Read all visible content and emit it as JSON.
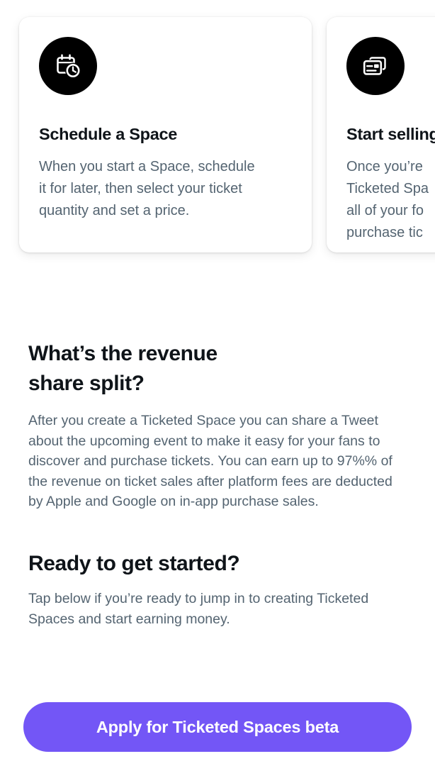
{
  "colors": {
    "page_background": "#ffffff",
    "card_background": "#ffffff",
    "heading_text": "#0f1419",
    "body_text": "#546471",
    "icon_badge": "#000000",
    "cta_background": "#7356f6",
    "cta_text": "#ffffff"
  },
  "cards": [
    {
      "icon": "calendar-clock-icon",
      "title": "Schedule a Space",
      "body": "When you start a Space, schedule\nit for later, then select your ticket\nquantity and set a price."
    },
    {
      "icon": "ticket-cards-icon",
      "title": "Start selling",
      "body": "Once you’re\nTicketed Spa\nall of your fo\npurchase tic"
    }
  ],
  "sections": [
    {
      "heading": "What’s the revenue\nshare split?",
      "body": "After you create a Ticketed Space you can share a Tweet about the upcoming event to make it easy for your fans to discover and purchase tickets. You can earn up to 97%% of the revenue on ticket sales after platform fees are deducted by Apple and Google on in-app purchase sales."
    },
    {
      "heading": "Ready to get started?",
      "body": "Tap below if you’re ready to jump in to creating Ticketed Spaces and start earning money."
    }
  ],
  "cta": {
    "label": "Apply for Ticketed Spaces beta"
  }
}
